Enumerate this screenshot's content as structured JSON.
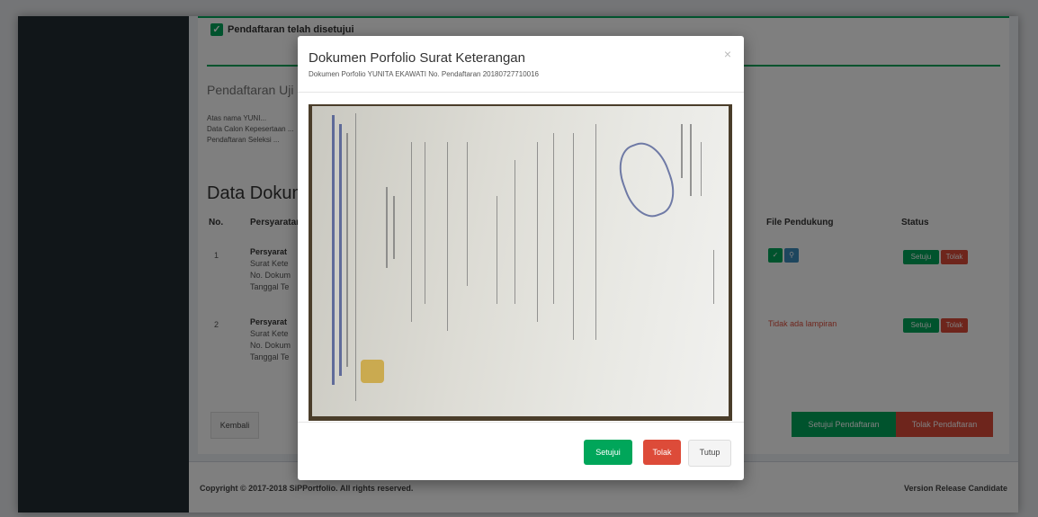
{
  "page": {
    "checkbox_label": "Pendaftaran telah disetujui",
    "section_title": "Pendaftaran Uji",
    "info_lines": [
      "Atas nama YUNI...",
      "Data Calon Kepesertaan ...",
      "Pendaftaran Seleksi ..."
    ],
    "data_title": "Data Dokumen",
    "table_headers": {
      "no": "No.",
      "persyaratan": "Persyaratan",
      "file": "File Pendukung",
      "status": "Status"
    },
    "rows": [
      {
        "no": "1",
        "title": "Persyarat",
        "lines": [
          "Surat Kete",
          "No. Dokum",
          "Tanggal Te"
        ],
        "file_text": ""
      },
      {
        "no": "2",
        "title": "Persyarat",
        "lines": [
          "Surat Kete",
          "No. Dokum",
          "Tanggal Te"
        ],
        "file_text": "Tidak ada lampiran"
      }
    ],
    "row_btn_approve": "Setuju",
    "row_btn_reject": "Tolak",
    "back_button": "Kembali",
    "approve_registration": "Setujui Pendaftaran",
    "reject_registration": "Tolak Pendaftaran",
    "footer_copyright": "Copyright © 2017-2018 SiPPortfolio. All rights reserved.",
    "footer_version": "Version Release Candidate"
  },
  "modal": {
    "title": "Dokumen Porfolio Surat Keterangan",
    "subtitle": "Dokumen Porfolio YUNITA EKAWATI No. Pendaftaran 20180727710016",
    "close_symbol": "×",
    "btn_approve": "Setujui",
    "btn_reject": "Tolak",
    "btn_close": "Tutup"
  },
  "colors": {
    "green": "#00a65a",
    "red": "#dd4b39",
    "blue": "#3c8dbc",
    "sidebar": "#222d32"
  }
}
